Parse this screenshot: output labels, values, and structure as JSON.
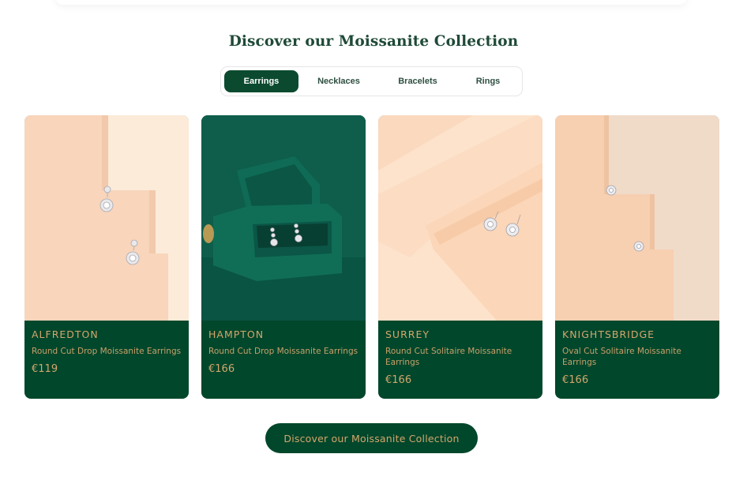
{
  "section": {
    "heading": "Discover our Moissanite Collection"
  },
  "tabs": [
    {
      "label": "Earrings",
      "active": true
    },
    {
      "label": "Necklaces",
      "active": false
    },
    {
      "label": "Bracelets",
      "active": false
    },
    {
      "label": "Rings",
      "active": false
    }
  ],
  "products": [
    {
      "name": "ALFREDTON",
      "description": "Round Cut Drop Moissanite Earrings",
      "price": "€119"
    },
    {
      "name": "HAMPTON",
      "description": "Round Cut Drop Moissanite Earrings",
      "price": "€166"
    },
    {
      "name": "SURREY",
      "description": "Round Cut Solitaire Moissanite Earrings",
      "price": "€166"
    },
    {
      "name": "KNIGHTSBRIDGE",
      "description": "Oval Cut Solitaire Moissanite Earrings",
      "price": "€166"
    }
  ],
  "cta": {
    "label": "Discover our Moissanite Collection"
  },
  "colors": {
    "brand_green": "#01472b",
    "gold_text": "#d4a66d",
    "heading_green": "#1f4a37",
    "peach": "#f9d9c2"
  }
}
